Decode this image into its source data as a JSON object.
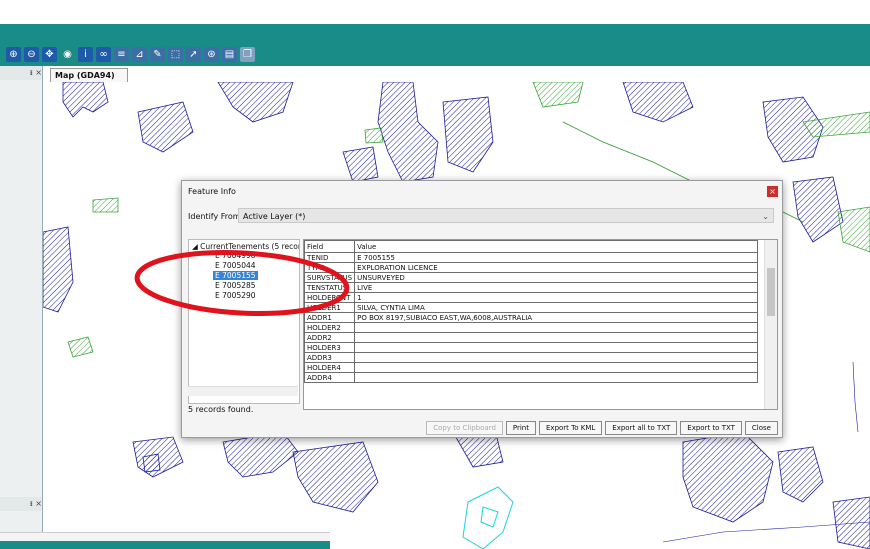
{
  "app": {
    "map_tab_title": "Map (GDA94)",
    "panel_controls": "ᵻ ×",
    "toolbar_icons": [
      "zoom-in-icon",
      "zoom-out-icon",
      "pan-icon",
      "zoom-extent-icon",
      "info-icon",
      "binoculars-icon",
      "layers-icon",
      "measure-icon",
      "draw-icon",
      "select-icon",
      "pointer-icon",
      "globe-icon",
      "print-icon",
      "copy-icon"
    ]
  },
  "dialog": {
    "title": "Feature Info",
    "close_glyph": "×",
    "identify_label": "Identify From",
    "identify_value": "Active Layer (*)",
    "tree_root": "CurrentTenements (5 recor",
    "tree_items": [
      "E 7004998",
      "E 7005044",
      "E 7005155",
      "E 7005285",
      "E 7005290"
    ],
    "selected_index": 2,
    "status": "5 records found.",
    "columns": [
      "Field",
      "Value"
    ],
    "rows": [
      [
        "TENID",
        "E 7005155"
      ],
      [
        "TYPE",
        "EXPLORATION LICENCE"
      ],
      [
        "SURVSTATUS",
        "UNSURVEYED"
      ],
      [
        "TENSTATUS",
        "LIVE"
      ],
      [
        "HOLDERCNT",
        "1"
      ],
      [
        "HOLDER1",
        "SILVA, CYNTIA LIMA"
      ],
      [
        "ADDR1",
        "PO BOX 8197,SUBIACO EAST,WA,6008,AUSTRALIA"
      ],
      [
        "HOLDER2",
        ""
      ],
      [
        "ADDR2",
        ""
      ],
      [
        "HOLDER3",
        ""
      ],
      [
        "ADDR3",
        ""
      ],
      [
        "HOLDER4",
        ""
      ],
      [
        "ADDR4",
        ""
      ]
    ],
    "buttons": {
      "copy": "Copy to Clipboard",
      "print": "Print",
      "kml": "Export To KML",
      "all_txt": "Export all to TXT",
      "txt": "Export to TXT",
      "close": "Close"
    }
  },
  "colors": {
    "teal": "#1a8c88",
    "highlight": "#3584d8",
    "annotation": "#e0121b"
  }
}
